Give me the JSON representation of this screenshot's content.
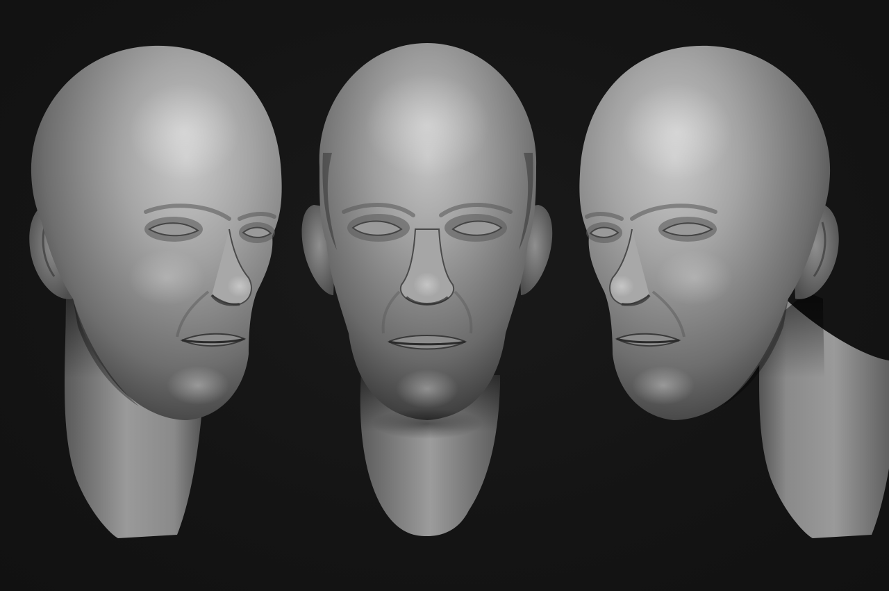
{
  "scene": {
    "background_color": "#141414",
    "material_color": "#8a8a8a",
    "views": [
      {
        "name": "three-quarter-left",
        "facing": "right"
      },
      {
        "name": "front",
        "facing": "viewer"
      },
      {
        "name": "three-quarter-right",
        "facing": "left"
      }
    ]
  }
}
